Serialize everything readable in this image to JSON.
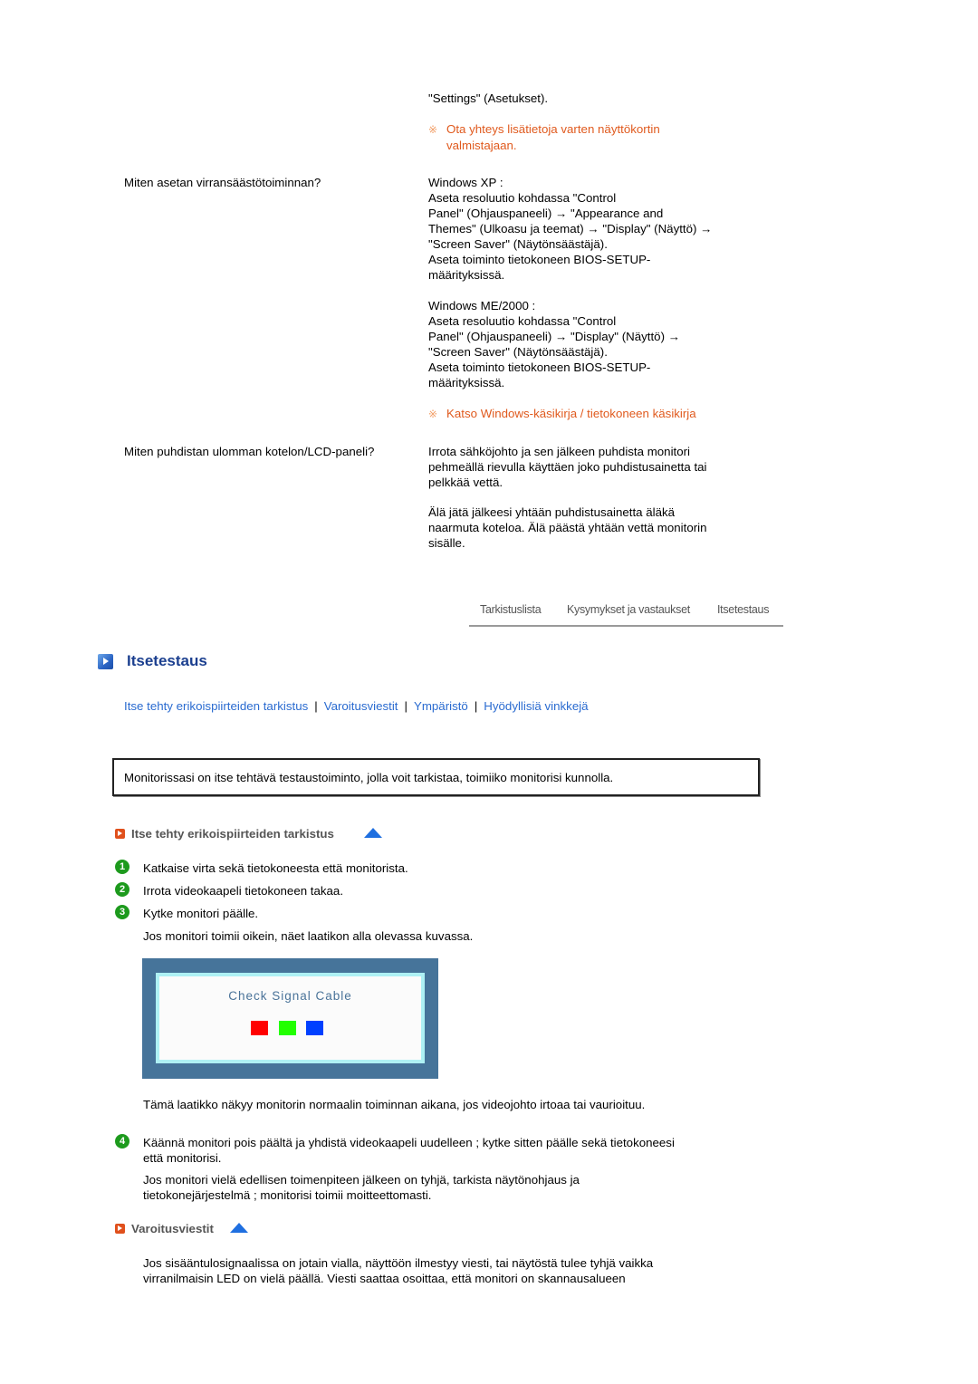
{
  "faq": {
    "top_answer_tail": "\"Settings\" (Asetukset).",
    "note1": {
      "icon": "reference-mark-icon",
      "glyph": "※",
      "lines": [
        "Ota yhteys lisätietoja varten näyttökortin",
        "valmistajaan."
      ]
    },
    "q2": "Miten asetan virransäästötoiminnan?",
    "a2_xp": [
      "Windows XP :",
      "Aseta resoluutio kohdassa \"Control",
      "Panel\" (Ohjauspaneeli) → \"Appearance and",
      "Themes\" (Ulkoasu ja teemat) → \"Display\" (Näyttö) →",
      "\"Screen Saver\" (Näytönsäästäjä).",
      "Aseta toiminto tietokoneen BIOS-SETUP-",
      "määrityksissä."
    ],
    "a2_me": [
      "Windows ME/2000 :",
      "Aseta resoluutio kohdassa \"Control",
      "Panel\" (Ohjauspaneeli) → \"Display\" (Näyttö) →",
      "\"Screen Saver\" (Näytönsäästäjä).",
      "Aseta toiminto tietokoneen BIOS-SETUP-",
      "määrityksissä."
    ],
    "note2": {
      "glyph": "※",
      "text": "Katso Windows-käsikirja / tietokoneen käsikirja"
    },
    "q3": "Miten puhdistan ulomman kotelon/LCD-paneli?",
    "a3_p1": [
      "Irrota sähköjohto ja sen jälkeen puhdista monitori",
      "pehmeällä rievulla käyttäen joko puhdistusainetta tai",
      "pelkkää vettä."
    ],
    "a3_p2": [
      "Älä jätä jälkeesi yhtään puhdistusainetta äläkä",
      "naarmuta koteloa. Älä päästä yhtään vettä monitorin",
      "sisälle."
    ]
  },
  "tabs": [
    {
      "label": "Tarkistuslista"
    },
    {
      "label": "Kysymykset ja vastaukset"
    },
    {
      "label": "Itsetestaus"
    }
  ],
  "page_title": "Itsetestaus",
  "navlinks": {
    "items": [
      "Itse tehty erikoispiirteiden tarkistus",
      "Varoitusviestit",
      "Ympäristö",
      "Hyödyllisiä vinkkejä"
    ],
    "separator": "|"
  },
  "infobox": "Monitorissasi on itse tehtävä testaustoiminto, jolla voit tarkistaa, toimiiko monitorisi kunnolla.",
  "section1": {
    "title": "Itse tehty erikoispiirteiden tarkistus",
    "steps": [
      {
        "num": "1",
        "text": "Katkaise virta sekä tietokoneesta että monitorista."
      },
      {
        "num": "2",
        "text": "Irrota videokaapeli tietokoneen takaa."
      },
      {
        "num": "3",
        "text": "Kytke monitori päälle."
      }
    ],
    "step3_note": "Jos monitori toimii oikein, näet laatikon alla olevassa kuvassa.",
    "monitor_image": {
      "message": "Check Signal Cable",
      "colors": [
        "#ff0000",
        "#22ff00",
        "#0040ff"
      ],
      "frame_color": "#46749a",
      "inner_border_color": "#aef1f4"
    },
    "image_caption": "Tämä laatikko näkyy monitorin normaalin toiminnan aikana, jos videojohto irtoaa tai vaurioituu.",
    "step4": {
      "num": "4",
      "lines": [
        "Käännä monitori pois päältä ja yhdistä videokaapeli uudelleen ; kytke sitten päälle sekä tietokoneesi",
        "että monitorisi."
      ]
    },
    "step4_note": [
      "Jos monitori vielä edellisen toimenpiteen jälkeen on tyhjä, tarkista näytönohjaus ja",
      "tietokonejärjestelmä ; monitorisi toimii moitteettomasti."
    ]
  },
  "section2": {
    "title": "Varoitusviestit",
    "text": [
      "Jos sisääntulosignaalissa on jotain vialla, näyttöön ilmestyy viesti, tai näytöstä tulee tyhjä vaikka",
      "virranilmaisin LED on vielä päällä. Viesti saattaa osoittaa, että monitori on skannausalueen"
    ]
  },
  "colors": {
    "note_orange": "#e05a1e",
    "link_blue": "#2a6bd0",
    "title_navy": "#1b3f8f",
    "step_green": "#1d9a1d",
    "section_icon_orange": "#e0501c",
    "up_arrow_blue": "#1f6fe0"
  }
}
